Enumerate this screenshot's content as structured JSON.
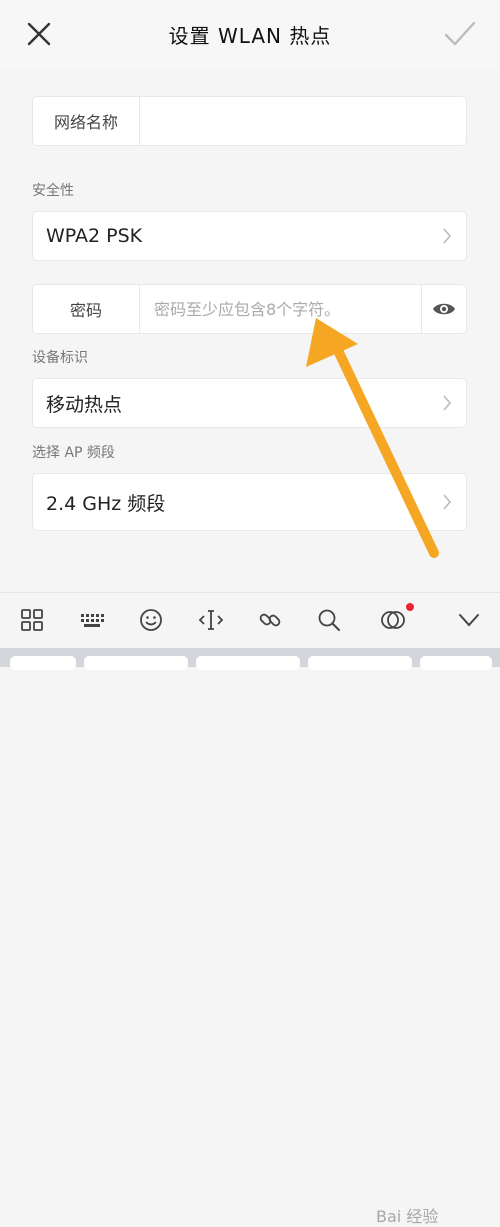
{
  "header": {
    "title": "设置 WLAN 热点",
    "close_icon": "close-icon",
    "confirm_icon": "checkmark-icon"
  },
  "network_name": {
    "label": "网络名称",
    "value": ""
  },
  "security": {
    "section_label": "安全性",
    "value": "WPA2 PSK"
  },
  "password": {
    "label": "密码",
    "placeholder": "密码至少应包含8个字符。",
    "toggle_icon": "eye-icon"
  },
  "device_id": {
    "section_label": "设备标识",
    "value": "移动热点"
  },
  "ap_band": {
    "section_label": "选择 AP 频段",
    "value": "2.4 GHz 频段"
  },
  "keyboard_toolbar": {
    "icons": [
      "grid-icon",
      "keyboard-icon",
      "emoji-icon",
      "cursor-icon",
      "link-icon",
      "search-icon",
      "bubble-icon",
      "chevron-down-icon"
    ],
    "notification_color": "#e22233"
  },
  "watermark": {
    "text": "Bai 经验"
  },
  "colors": {
    "arrow": "#f5a623",
    "background": "#f5f5f5"
  }
}
